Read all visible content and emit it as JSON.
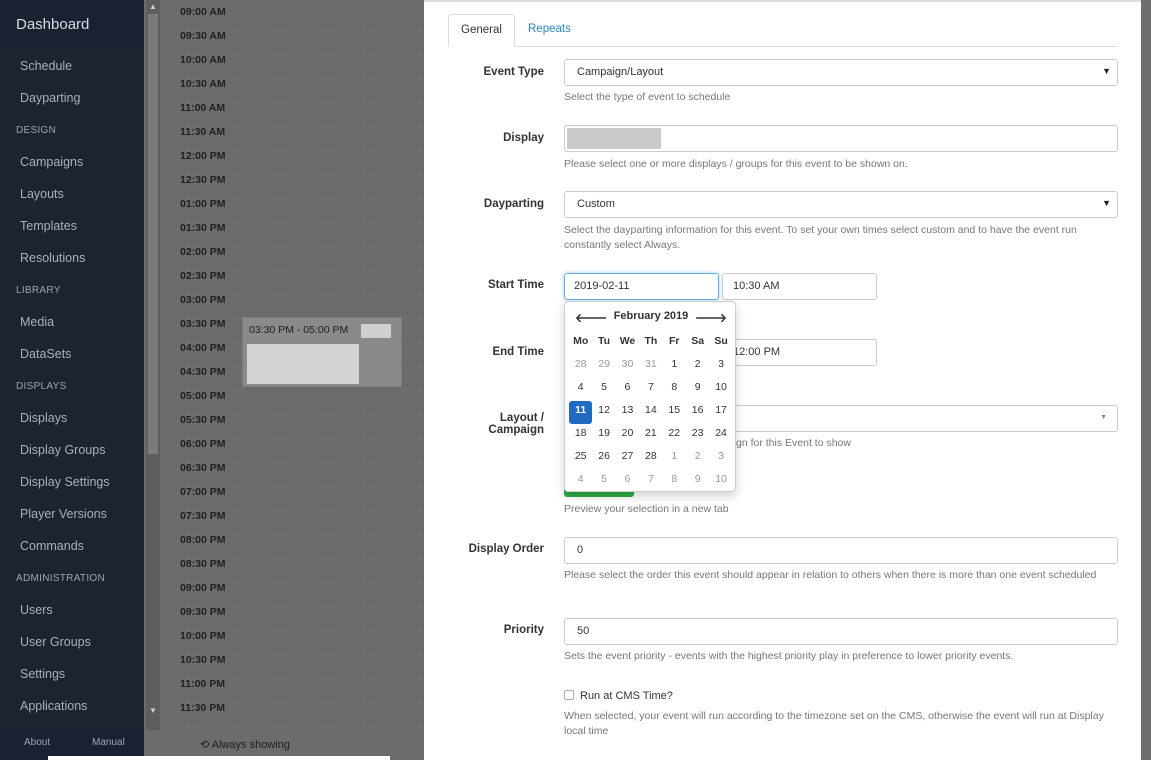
{
  "sidebar": {
    "title": "Dashboard",
    "items_top": [
      "Schedule",
      "Dayparting"
    ],
    "section_design": "DESIGN",
    "items_design": [
      "Campaigns",
      "Layouts",
      "Templates",
      "Resolutions"
    ],
    "section_library": "LIBRARY",
    "items_library": [
      "Media",
      "DataSets"
    ],
    "section_displays": "DISPLAYS",
    "items_displays": [
      "Displays",
      "Display Groups",
      "Display Settings",
      "Player Versions",
      "Commands"
    ],
    "section_admin": "ADMINISTRATION",
    "items_admin": [
      "Users",
      "User Groups",
      "Settings",
      "Applications"
    ],
    "footer_about": "About",
    "footer_manual": "Manual"
  },
  "calendar": {
    "slots": [
      "09:00 AM",
      "09:30 AM",
      "10:00 AM",
      "10:30 AM",
      "11:00 AM",
      "11:30 AM",
      "12:00 PM",
      "12:30 PM",
      "01:00 PM",
      "01:30 PM",
      "02:00 PM",
      "02:30 PM",
      "03:00 PM",
      "03:30 PM",
      "04:00 PM",
      "04:30 PM",
      "05:00 PM",
      "05:30 PM",
      "06:00 PM",
      "06:30 PM",
      "07:00 PM",
      "07:30 PM",
      "08:00 PM",
      "08:30 PM",
      "09:00 PM",
      "09:30 PM",
      "10:00 PM",
      "10:30 PM",
      "11:00 PM",
      "11:30 PM"
    ],
    "event_time": "03:30 PM - 05:00 PM",
    "legend": "Always showing"
  },
  "modal": {
    "tabs": [
      "General",
      "Repeats"
    ],
    "event_type": {
      "label": "Event Type",
      "value": "Campaign/Layout",
      "help": "Select the type of event to schedule"
    },
    "display": {
      "label": "Display",
      "help": "Please select one or more displays / groups for this event to be shown on."
    },
    "dayparting": {
      "label": "Dayparting",
      "value": "Custom",
      "help": "Select the dayparting information for this event. To set your own times select custom and to have the event run constantly select Always."
    },
    "start_time": {
      "label": "Start Time",
      "date": "2019-02-11",
      "time": "10:30 AM"
    },
    "end_time": {
      "label": "End Time",
      "time": "12:00 PM"
    },
    "layout_campaign": {
      "label_line1": "Layout /",
      "label_line2": "Campaign",
      "help_partial": "gn for this Event to show"
    },
    "preview_help": "Preview your selection in a new tab",
    "display_order": {
      "label": "Display Order",
      "value": "0",
      "help": "Please select the order this event should appear in relation to others when there is more than one event scheduled"
    },
    "priority": {
      "label": "Priority",
      "value": "50",
      "help": "Sets the event priority - events with the highest priority play in preference to lower priority events."
    },
    "cms_time": {
      "label": "Run at CMS Time?",
      "help": "When selected, your event will run according to the timezone set on the CMS, otherwise the event will run at Display local time"
    }
  },
  "datepicker": {
    "prev": "🡐",
    "next": "🡒",
    "month": "February 2019",
    "dow": [
      "Mo",
      "Tu",
      "We",
      "Th",
      "Fr",
      "Sa",
      "Su"
    ],
    "weeks": [
      [
        "28",
        "29",
        "30",
        "31",
        "1",
        "2",
        "3"
      ],
      [
        "4",
        "5",
        "6",
        "7",
        "8",
        "9",
        "10"
      ],
      [
        "11",
        "12",
        "13",
        "14",
        "15",
        "16",
        "17"
      ],
      [
        "18",
        "19",
        "20",
        "21",
        "22",
        "23",
        "24"
      ],
      [
        "25",
        "26",
        "27",
        "28",
        "1",
        "2",
        "3"
      ],
      [
        "4",
        "5",
        "6",
        "7",
        "8",
        "9",
        "10"
      ]
    ],
    "selected": "11"
  },
  "colors": {
    "sidebar_bg": "#1c2431",
    "accent_blue": "#2a84c6",
    "selected_day": "#1f6bc1",
    "preview_green": "#2eaa45"
  },
  "icons": {
    "prev": "arrow-left-icon",
    "next": "arrow-right-icon",
    "select_caret": "caret-down-icon",
    "legend": "repeat-icon"
  }
}
